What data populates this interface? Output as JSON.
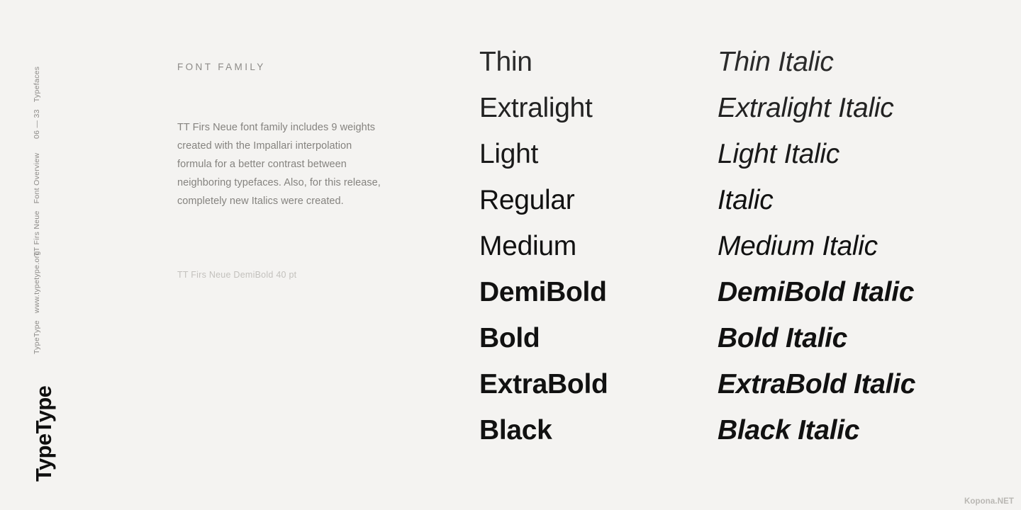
{
  "background_color": "#f4f3f1",
  "rail": {
    "blocks": [
      {
        "line1": "06  —  33",
        "line2": "Typefaces"
      },
      {
        "line1": "TT Firs Neue",
        "line2": "Font Overview"
      },
      {
        "line1": "TypeType",
        "line2": "www.typetype.org"
      }
    ],
    "logo": "TypeType"
  },
  "description": {
    "heading": "FONT FAMILY",
    "body": "TT Firs Neue font family includes 9 weights created with the Impallari interpolation formula for a better contrast between neighboring typefaces. Also, for this release, completely new Italics were created.",
    "caption": "TT Firs Neue DemiBold 40 pt"
  },
  "specimen": {
    "rows": [
      {
        "upright": "Thin",
        "italic": "Thin Italic"
      },
      {
        "upright": "Extralight",
        "italic": "Extralight Italic"
      },
      {
        "upright": "Light",
        "italic": "Light Italic"
      },
      {
        "upright": "Regular",
        "italic": "Italic"
      },
      {
        "upright": "Medium",
        "italic": "Medium Italic"
      },
      {
        "upright": "DemiBold",
        "italic": "DemiBold Italic"
      },
      {
        "upright": "Bold",
        "italic": "Bold Italic"
      },
      {
        "upright": "ExtraBold",
        "italic": "ExtraBold Italic"
      },
      {
        "upright": "Black",
        "italic": "Black Italic"
      }
    ]
  },
  "watermark": "Kopona.NET"
}
